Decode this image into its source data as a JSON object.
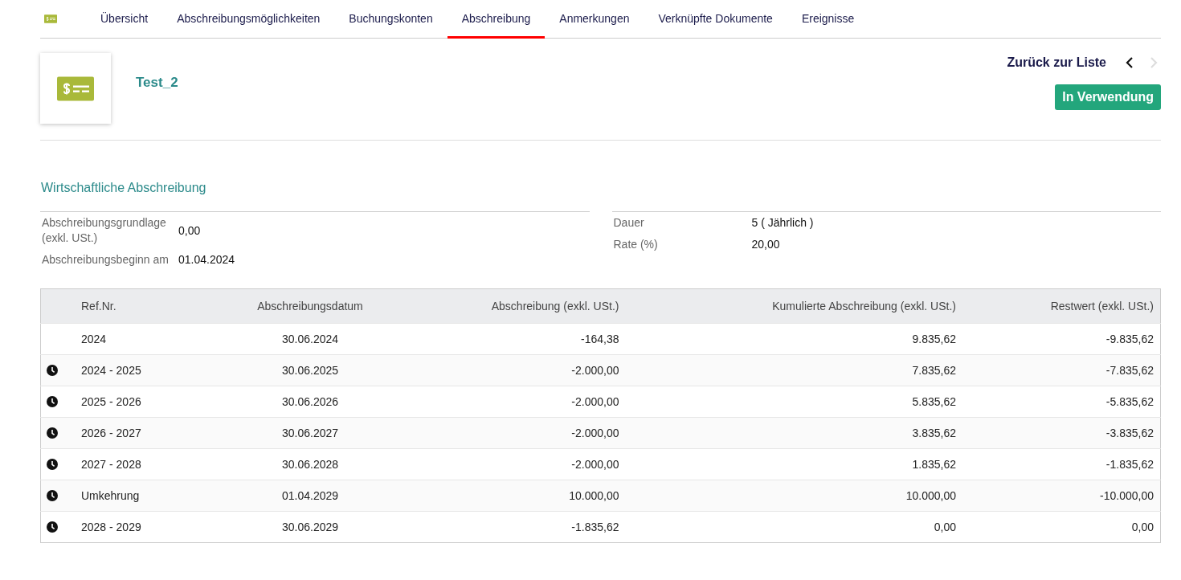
{
  "tabs": [
    {
      "label": "Übersicht",
      "selected": false
    },
    {
      "label": "Abschreibungsmöglichkeiten",
      "selected": false
    },
    {
      "label": "Buchungskonten",
      "selected": false
    },
    {
      "label": "Abschreibung",
      "selected": true
    },
    {
      "label": "Anmerkungen",
      "selected": false
    },
    {
      "label": "Verknüpfte Dokumente",
      "selected": false
    },
    {
      "label": "Ereignisse",
      "selected": false
    }
  ],
  "asset": {
    "name": "Test_2",
    "back_link": "Zurück zur Liste",
    "prev_disabled": false,
    "next_disabled": true,
    "status": "In Verwendung"
  },
  "section_title": "Wirtschaftliche Abschreibung",
  "fields_left": [
    {
      "label": "Abschreibungsgrundlage (exkl. USt.)",
      "value": "0,00"
    },
    {
      "label": "Abschreibungsbeginn am",
      "value": "01.04.2024"
    }
  ],
  "fields_right": [
    {
      "label": "Dauer",
      "value": "5 ( Jährlich )"
    },
    {
      "label": "Rate (%)",
      "value": "20,00"
    }
  ],
  "table": {
    "columns": [
      "Ref.Nr.",
      "Abschreibungsdatum",
      "Abschreibung (exkl. USt.)",
      "Kumulierte Abschreibung (exkl. USt.)",
      "Restwert (exkl. USt.)"
    ],
    "rows": [
      {
        "pending": false,
        "cells": [
          "2024",
          "30.06.2024",
          "-164,38",
          "9.835,62",
          "-9.835,62"
        ]
      },
      {
        "pending": true,
        "cells": [
          "2024 - 2025",
          "30.06.2025",
          "-2.000,00",
          "7.835,62",
          "-7.835,62"
        ]
      },
      {
        "pending": true,
        "cells": [
          "2025 - 2026",
          "30.06.2026",
          "-2.000,00",
          "5.835,62",
          "-5.835,62"
        ]
      },
      {
        "pending": true,
        "cells": [
          "2026 - 2027",
          "30.06.2027",
          "-2.000,00",
          "3.835,62",
          "-3.835,62"
        ]
      },
      {
        "pending": true,
        "cells": [
          "2027 - 2028",
          "30.06.2028",
          "-2.000,00",
          "1.835,62",
          "-1.835,62"
        ]
      },
      {
        "pending": true,
        "cells": [
          "Umkehrung",
          "01.04.2029",
          "10.000,00",
          "10.000,00",
          "-10.000,00"
        ]
      },
      {
        "pending": true,
        "cells": [
          "2028 - 2029",
          "30.06.2029",
          "-1.835,62",
          "0,00",
          "0,00"
        ]
      }
    ]
  }
}
